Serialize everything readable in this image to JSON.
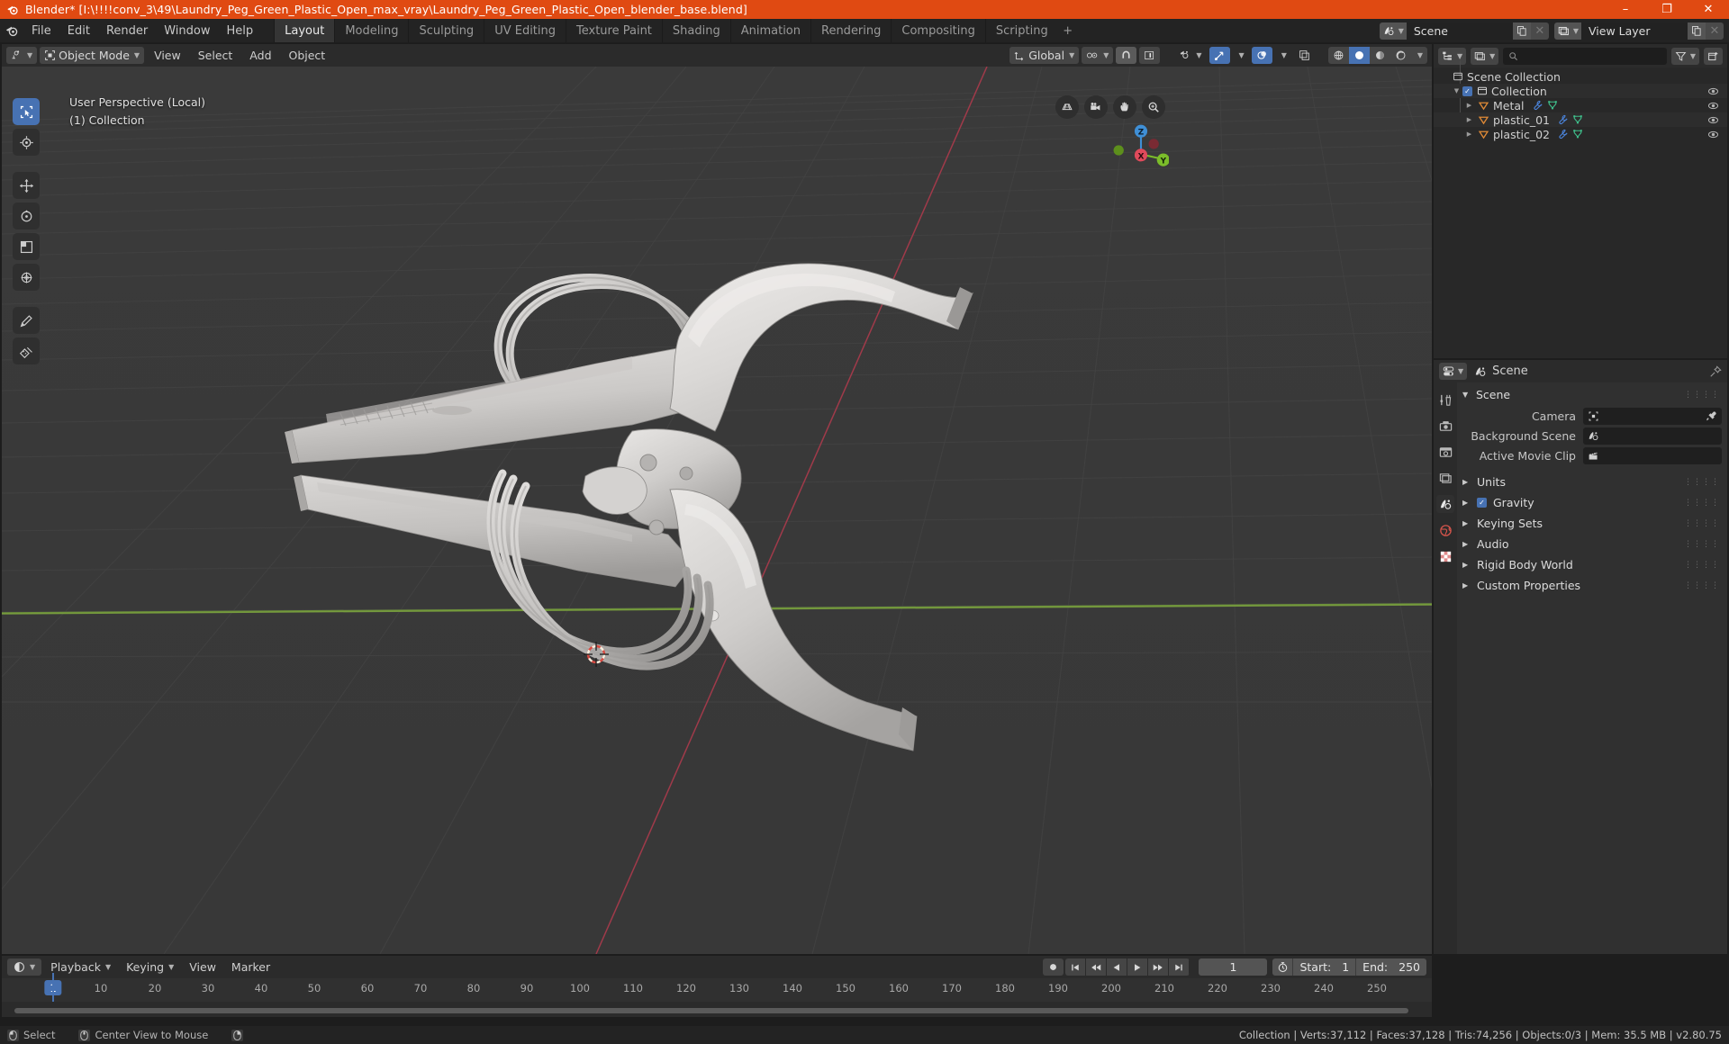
{
  "window": {
    "title": "Blender* [I:\\!!!!conv_3\\49\\Laundry_Peg_Green_Plastic_Open_max_vray\\Laundry_Peg_Green_Plastic_Open_blender_base.blend]",
    "minimize": "–",
    "maximize": "❐",
    "close": "✕",
    "accent": "#e04a12"
  },
  "topbar": {
    "menus": [
      "File",
      "Edit",
      "Render",
      "Window",
      "Help"
    ],
    "workspaces": [
      {
        "label": "Layout",
        "active": true
      },
      {
        "label": "Modeling",
        "active": false
      },
      {
        "label": "Sculpting",
        "active": false
      },
      {
        "label": "UV Editing",
        "active": false
      },
      {
        "label": "Texture Paint",
        "active": false
      },
      {
        "label": "Shading",
        "active": false
      },
      {
        "label": "Animation",
        "active": false
      },
      {
        "label": "Rendering",
        "active": false
      },
      {
        "label": "Compositing",
        "active": false
      },
      {
        "label": "Scripting",
        "active": false
      }
    ],
    "add_workspace": "+",
    "scene_name": "Scene",
    "view_layer_name": "View Layer"
  },
  "viewport": {
    "mode": "Object Mode",
    "menus": [
      "View",
      "Select",
      "Add",
      "Object"
    ],
    "transform_orientation": "Global",
    "overlay_line1": "User Perspective (Local)",
    "overlay_line2": "(1) Collection",
    "gizmo_axes": {
      "x": "X",
      "y": "Y",
      "z": "Z"
    }
  },
  "outliner": {
    "search_placeholder": "",
    "rows": [
      {
        "label": "Scene Collection",
        "indent": 0,
        "icon": "collection-icon",
        "disclosure": "",
        "checkbox": false,
        "eye": false,
        "modifiers": []
      },
      {
        "label": "Collection",
        "indent": 1,
        "icon": "collection-icon",
        "disclosure": "▼",
        "checkbox": true,
        "eye": true,
        "modifiers": []
      },
      {
        "label": "Metal",
        "indent": 2,
        "icon": "mesh-object-icon",
        "disclosure": "▶",
        "checkbox": false,
        "eye": true,
        "modifiers": [
          "wrench-icon",
          "mesh-data-icon"
        ]
      },
      {
        "label": "plastic_01",
        "indent": 2,
        "icon": "mesh-object-icon",
        "disclosure": "▶",
        "checkbox": false,
        "eye": true,
        "modifiers": [
          "wrench-icon",
          "mesh-data-icon"
        ]
      },
      {
        "label": "plastic_02",
        "indent": 2,
        "icon": "mesh-object-icon",
        "disclosure": "▶",
        "checkbox": false,
        "eye": true,
        "modifiers": [
          "wrench-icon",
          "mesh-data-icon"
        ]
      }
    ]
  },
  "properties": {
    "breadcrumb": "Scene",
    "panel_title": "Scene",
    "fields": [
      {
        "label": "Camera",
        "value": "",
        "icon": "camera-object-icon",
        "eyedropper": true
      },
      {
        "label": "Background Scene",
        "value": "",
        "icon": "scene-icon",
        "eyedropper": false
      },
      {
        "label": "Active Movie Clip",
        "value": "",
        "icon": "clip-icon",
        "eyedropper": false
      }
    ],
    "sections": [
      {
        "label": "Units",
        "checkbox": false
      },
      {
        "label": "Gravity",
        "checkbox": true
      },
      {
        "label": "Keying Sets",
        "checkbox": false
      },
      {
        "label": "Audio",
        "checkbox": false
      },
      {
        "label": "Rigid Body World",
        "checkbox": false
      },
      {
        "label": "Custom Properties",
        "checkbox": false
      }
    ],
    "tabs": [
      "tool-icon",
      "render-icon",
      "output-icon",
      "view-layer-icon",
      "scene-icon",
      "world-icon",
      "texture-icon"
    ]
  },
  "timeline": {
    "menus": [
      "Playback",
      "Keying",
      "View",
      "Marker"
    ],
    "current_frame": "1",
    "start_label": "Start:",
    "start_value": "1",
    "end_label": "End:",
    "end_value": "250",
    "ticks": [
      "10",
      "20",
      "30",
      "40",
      "50",
      "60",
      "70",
      "80",
      "90",
      "100",
      "110",
      "120",
      "130",
      "140",
      "150",
      "160",
      "170",
      "180",
      "190",
      "200",
      "210",
      "220",
      "230",
      "240",
      "250"
    ],
    "playhead_label": "1"
  },
  "statusbar": {
    "left_items": [
      {
        "key": "mouse-left-icon",
        "label": "Select"
      },
      {
        "key": "mouse-middle-icon",
        "label": "Center View to Mouse"
      },
      {
        "key": "mouse-right-icon",
        "label": ""
      }
    ],
    "stats": "Collection | Verts:37,112 | Faces:37,128 | Tris:74,256 | Objects:0/3 | Mem: 35.5 MB | v2.80.75"
  }
}
